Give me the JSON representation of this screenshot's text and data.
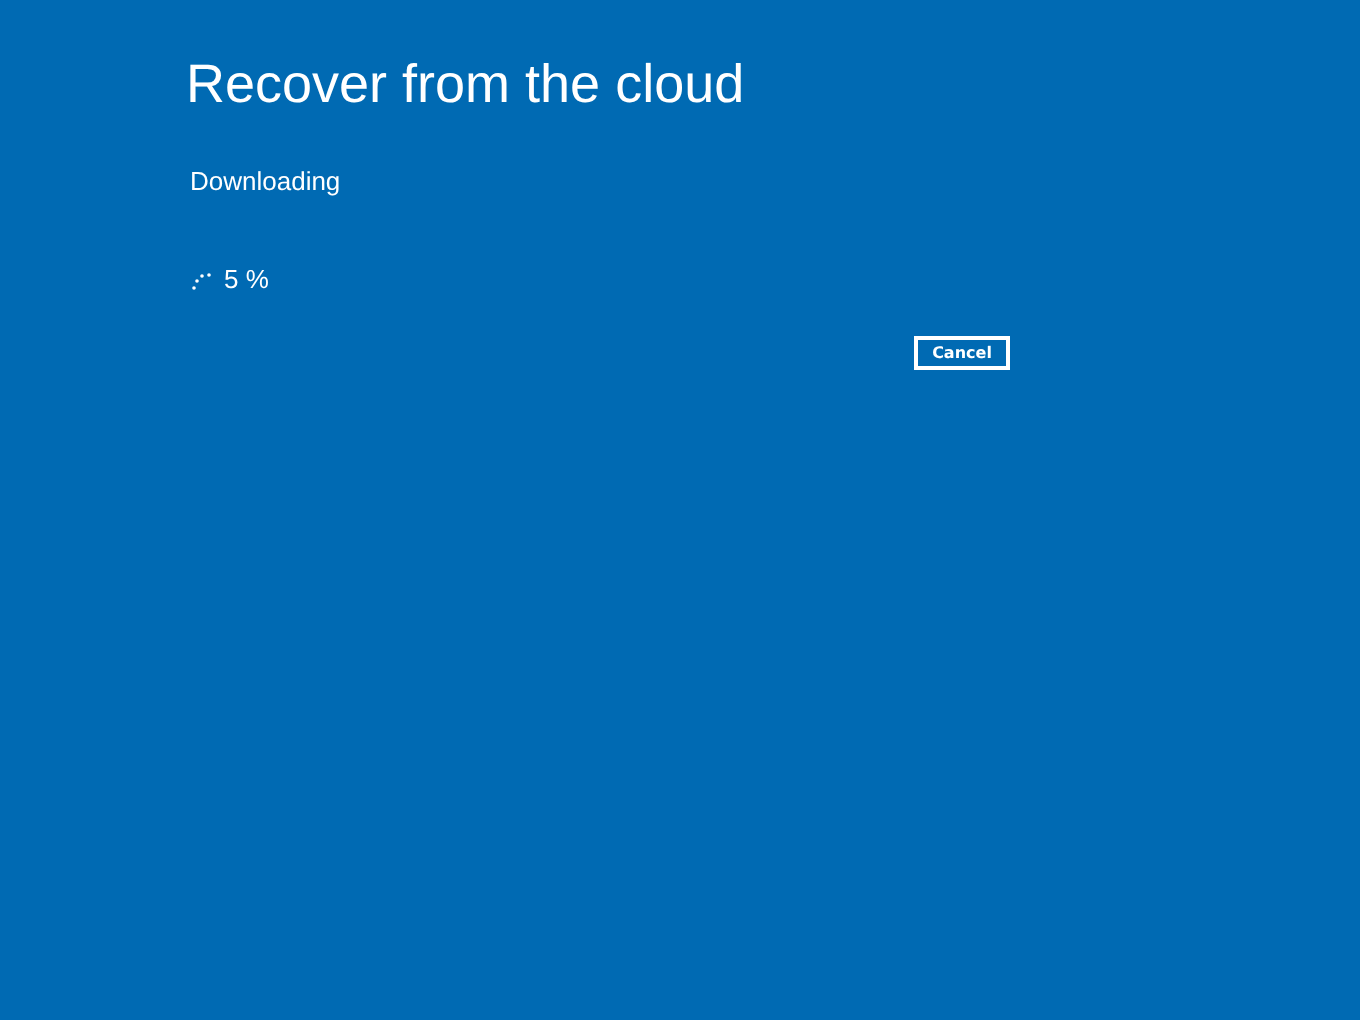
{
  "title": "Recover from the cloud",
  "status": "Downloading",
  "progress": {
    "reading": "5 %"
  },
  "buttons": [
    "Cancel"
  ]
}
